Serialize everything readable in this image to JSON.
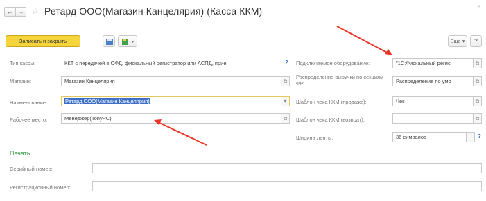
{
  "window": {
    "title": "Ретард ООО(Магазин Канцелярия) (Касса ККМ)",
    "close": "×"
  },
  "nav": {
    "back": "←",
    "forward": "→",
    "star": "☆"
  },
  "toolbar": {
    "save_close": "Записать и закрыть",
    "more": "Еще",
    "help": "?"
  },
  "form": {
    "left": [
      {
        "label": "Тип кассы:",
        "value": "ККТ с передачей в ОФД, фискальный регистратор или АСПД, прие"
      },
      {
        "label": "Магазин:",
        "value": "Магазин Канцелярия"
      },
      {
        "label": "Наименование:",
        "value": "Ретард ООО(Магазин Канцелярия)"
      },
      {
        "label": "Рабочее место:",
        "value": "Менеджер(TonyPC)"
      }
    ],
    "right": [
      {
        "label": "Подключаемое оборудование:",
        "value": "\"1С:Фискальный регис"
      },
      {
        "label": "Распределение выручки по секциям ФР:",
        "value": "Распределение по умо"
      },
      {
        "label": "Шаблон чека ККМ (продажа):",
        "value": "Чек"
      },
      {
        "label": "Шаблон чека ККМ (возврат):",
        "value": ""
      },
      {
        "label": "Ширина ленты:",
        "value": "36 символов"
      }
    ],
    "help_mark": "?"
  },
  "print_section": {
    "header": "Печать",
    "serial_label": "Серийный номер:",
    "serial_value": "",
    "reg_label": "Регистрационный номер:",
    "reg_value": ""
  },
  "colors": {
    "save_button": "#f5d43c",
    "accent_green": "#3a9a49",
    "selection": "#3d6fc7",
    "annotation_arrow": "#e8362a"
  }
}
